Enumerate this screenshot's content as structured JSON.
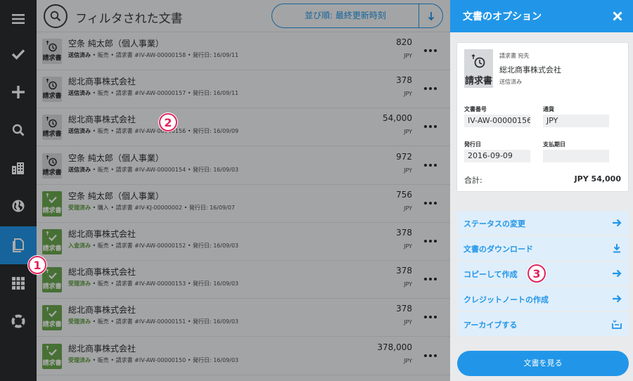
{
  "rail": {
    "items": [
      {
        "icon": "menu-icon"
      },
      {
        "icon": "check-icon"
      },
      {
        "icon": "plus-icon"
      },
      {
        "icon": "search-icon"
      },
      {
        "icon": "company-icon"
      },
      {
        "icon": "globe-icon"
      },
      {
        "icon": "document-icon",
        "active": true
      },
      {
        "icon": "grid-icon"
      },
      {
        "icon": "lifebuoy-icon"
      }
    ]
  },
  "topbar": {
    "title": "フィルタされた文書",
    "sort_label": "並び順: 最終更新時刻"
  },
  "documents": [
    {
      "name": "空条 純太郎（個人事業）",
      "status": "送信済み",
      "meta": " • 販売 • 請求書 #IV-AW-00000158 • 発行日: 16/09/11",
      "amount": "820",
      "currency": "JPY",
      "kind": "請求書",
      "state": "pending"
    },
    {
      "name": "総北商事株式会社",
      "status": "送信済み",
      "meta": " • 販売 • 請求書 #IV-AW-00000157 • 発行日: 16/09/11",
      "amount": "378",
      "currency": "JPY",
      "kind": "請求書",
      "state": "pending"
    },
    {
      "name": "総北商事株式会社",
      "status": "送信済み",
      "meta": " • 販売 • 請求書 #IV-AW-00000156 • 発行日: 16/09/09",
      "amount": "54,000",
      "currency": "JPY",
      "kind": "請求書",
      "state": "pending"
    },
    {
      "name": "空条 純太郎（個人事業）",
      "status": "送信済み",
      "meta": " • 販売 • 請求書 #IV-AW-00000154 • 発行日: 16/09/03",
      "amount": "972",
      "currency": "JPY",
      "kind": "請求書",
      "state": "pending"
    },
    {
      "name": "空条 純太郎（個人事業）",
      "status": "受理済み",
      "meta": " • 購入 • 請求書 #IV-KJ-00000002 • 発行日: 16/09/07",
      "amount": "756",
      "currency": "JPY",
      "kind": "請求書",
      "state": "done"
    },
    {
      "name": "総北商事株式会社",
      "status": "入金済み",
      "meta": " • 販売 • 請求書 #IV-AW-00000152 • 発行日: 16/09/03",
      "amount": "378",
      "currency": "JPY",
      "kind": "請求書",
      "state": "done"
    },
    {
      "name": "総北商事株式会社",
      "status": "受理済み",
      "meta": " • 販売 • 請求書 #IV-AW-00000153 • 発行日: 16/09/03",
      "amount": "378",
      "currency": "JPY",
      "kind": "請求書",
      "state": "done"
    },
    {
      "name": "総北商事株式会社",
      "status": "受理済み",
      "meta": " • 販売 • 請求書 #IV-AW-00000151 • 発行日: 16/09/03",
      "amount": "378",
      "currency": "JPY",
      "kind": "請求書",
      "state": "done"
    },
    {
      "name": "総北商事株式会社",
      "status": "受理済み",
      "meta": " • 販売 • 請求書 #IV-AW-00000150 • 発行日: 16/09/03",
      "amount": "378,000",
      "currency": "JPY",
      "kind": "請求書",
      "state": "done"
    }
  ],
  "panel": {
    "title": "文書のオプション",
    "card": {
      "kind": "請求書",
      "to_label": "請求書 宛先",
      "recipient": "総北商事株式会社",
      "status": "送信済み",
      "doc_no_label": "文書番号",
      "doc_no_value": "IV-AW-00000156",
      "currency_label": "通貨",
      "currency_value": "JPY",
      "issue_label": "発行日",
      "issue_value": "2016-09-09",
      "due_label": "支払期日",
      "due_value": "",
      "total_label": "合計:",
      "total_value": "JPY 54,000"
    },
    "actions": [
      {
        "label": "ステータスの変更",
        "icon": "arrow-right-icon"
      },
      {
        "label": "文書のダウンロード",
        "icon": "download-icon"
      },
      {
        "label": "コピーして作成",
        "icon": "arrow-right-icon"
      },
      {
        "label": "クレジットノートの作成",
        "icon": "arrow-right-icon"
      },
      {
        "label": "アーカイブする",
        "icon": "archive-icon"
      }
    ],
    "view_button": "文書を見る"
  },
  "markers": [
    "1",
    "2",
    "3"
  ],
  "colors": {
    "accent": "#2196e8",
    "marker": "#e0245e",
    "done": "#6aa84f"
  }
}
